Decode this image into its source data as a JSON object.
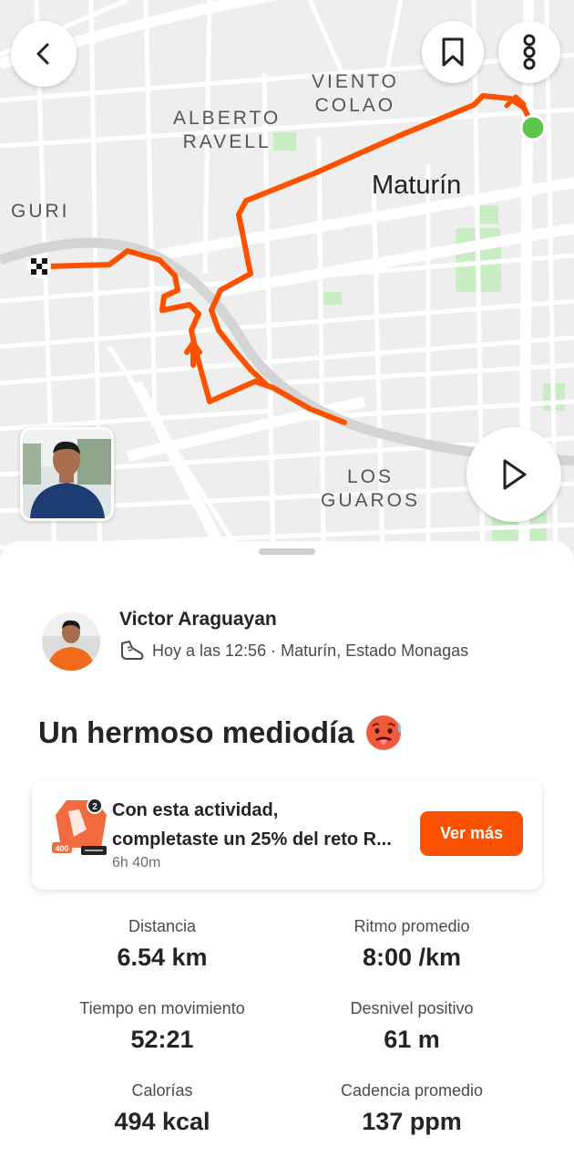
{
  "map": {
    "labels": {
      "viento_colao_1": "VIENTO",
      "viento_colao_2": "COLAO",
      "alberto_ravell_1": "ALBERTO",
      "alberto_ravell_2": "RAVELL",
      "guri": "GURI",
      "maturin": "Maturín",
      "los_guaros_1": "LOS",
      "los_guaros_2": "GUAROS"
    },
    "route_color": "#fc5200",
    "start_marker_color": "#5cc64a"
  },
  "toolbar": {
    "back_icon": "chevron-left-icon",
    "bookmark_icon": "bookmark-icon",
    "more_icon": "more-vertical-icon",
    "play_icon": "play-icon"
  },
  "athlete": {
    "name": "Victor Araguayan",
    "meta": "Hoy a las 12:56 · Maturín, Estado Monagas"
  },
  "activity": {
    "title": "Un hermoso mediodía"
  },
  "challenge": {
    "line1": "Con esta actividad,",
    "line2": "completaste un 25% del reto R...",
    "time": "6h 40m",
    "button_label": "Ver más",
    "badge_text": "400",
    "accent": "#fc5200"
  },
  "stats": [
    {
      "label": "Distancia",
      "value": "6.54 km"
    },
    {
      "label": "Ritmo promedio",
      "value": "8:00 /km"
    },
    {
      "label": "Tiempo en movimiento",
      "value": "52:21"
    },
    {
      "label": "Desnivel positivo",
      "value": "61 m"
    },
    {
      "label": "Calorías",
      "value": "494 kcal"
    },
    {
      "label": "Cadencia promedio",
      "value": "137 ppm"
    }
  ]
}
